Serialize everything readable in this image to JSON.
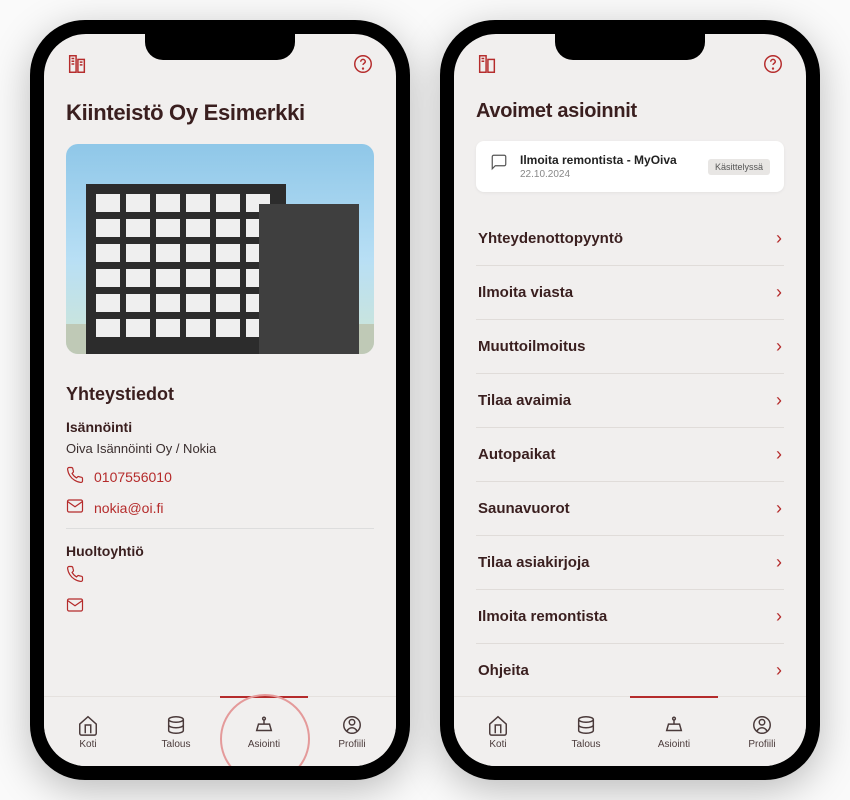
{
  "colors": {
    "accent": "#b52b2b"
  },
  "phone1": {
    "title": "Kiinteistö Oy Esimerkki",
    "contacts_heading": "Yhteystiedot",
    "management_heading": "Isännöinti",
    "management_name": "Oiva Isännöinti Oy / Nokia",
    "management_phone": "0107556010",
    "management_email": "nokia@oi.fi",
    "maintenance_heading": "Huoltoyhtiö"
  },
  "phone2": {
    "title": "Avoimet asioinnit",
    "open_case": {
      "title": "Ilmoita remontista - MyOiva",
      "date": "22.10.2024",
      "status": "Käsittelyssä"
    },
    "menu": [
      "Yhteydenottopyyntö",
      "Ilmoita viasta",
      "Muuttoilmoitus",
      "Tilaa avaimia",
      "Autopaikat",
      "Saunavuorot",
      "Tilaa asiakirjoja",
      "Ilmoita remontista",
      "Ohjeita"
    ]
  },
  "nav": {
    "items": [
      "Koti",
      "Talous",
      "Asiointi",
      "Profiili"
    ],
    "active_index": 2
  }
}
